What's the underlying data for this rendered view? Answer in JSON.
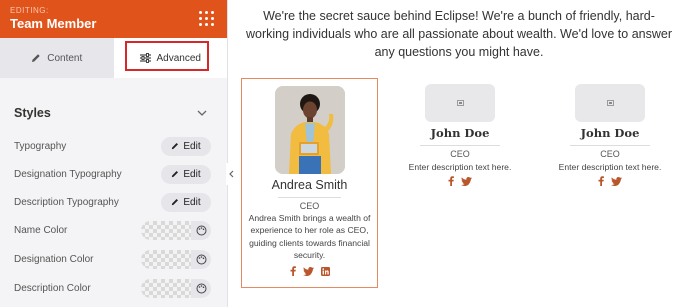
{
  "sidebar": {
    "editing_label": "EDITING:",
    "title": "Team Member",
    "tabs": [
      {
        "label": "Content"
      },
      {
        "label": "Advanced"
      }
    ],
    "styles_title": "Styles",
    "rows": [
      {
        "label": "Typography",
        "control": "Edit"
      },
      {
        "label": "Designation Typography",
        "control": "Edit"
      },
      {
        "label": "Description Typography",
        "control": "Edit"
      },
      {
        "label": "Name Color"
      },
      {
        "label": "Designation Color"
      },
      {
        "label": "Description Color"
      }
    ],
    "accent_color": "#e0531b",
    "highlight_color": "#d7272b"
  },
  "main": {
    "intro": "We're the secret sauce behind Eclipse! We're a bunch of friendly, hard-working individuals who are all passionate about wealth. We'd love to answer any questions you might have.",
    "cards": [
      {
        "name": "Andrea Smith",
        "role": "CEO",
        "description": "Andrea Smith brings a wealth of experience to her role as CEO, guiding clients towards financial security.",
        "socials": [
          "facebook-icon",
          "twitter-icon",
          "linkedin-icon"
        ],
        "social_color": "#b9562c"
      },
      {
        "name": "John Doe",
        "role": "CEO",
        "description": "Enter description text here.",
        "socials": [
          "facebook-icon",
          "twitter-icon"
        ],
        "social_color": "#b9562c"
      },
      {
        "name": "John Doe",
        "role": "CEO",
        "description": "Enter description text here.",
        "socials": [
          "facebook-icon",
          "twitter-icon"
        ],
        "social_color": "#b9562c"
      }
    ]
  }
}
